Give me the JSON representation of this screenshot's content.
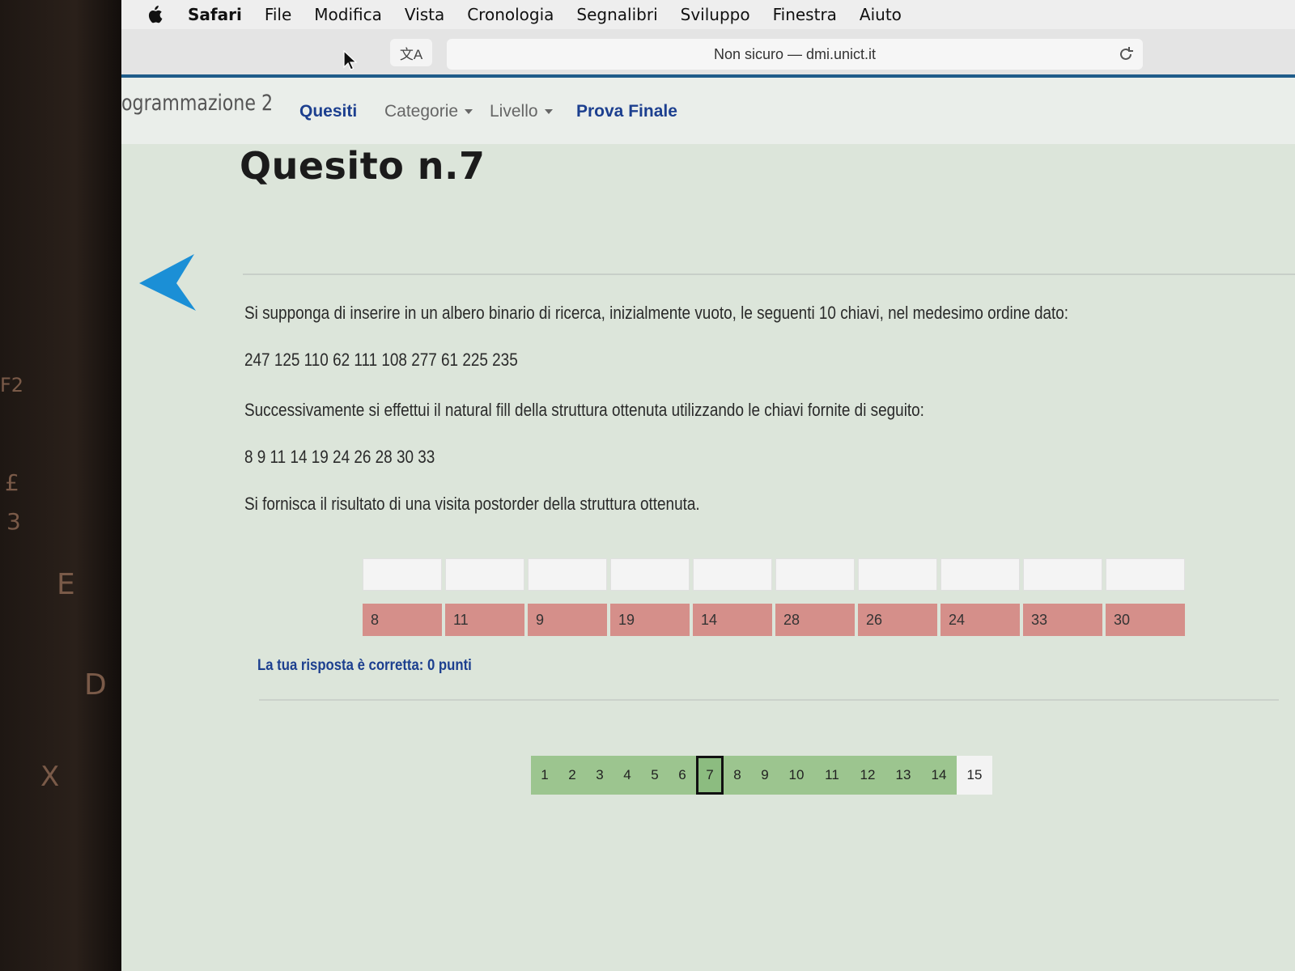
{
  "keyboard": {
    "keys": [
      "F2",
      "£",
      "3",
      "E",
      "D",
      "X"
    ]
  },
  "menubar": {
    "app": "Safari",
    "items": [
      "File",
      "Modifica",
      "Vista",
      "Cronologia",
      "Segnalibri",
      "Sviluppo",
      "Finestra",
      "Aiuto"
    ]
  },
  "toolbar": {
    "translate_label": "文A",
    "address": "Non sicuro — dmi.unict.it"
  },
  "navbar": {
    "brand": "ogrammazione 2",
    "links": {
      "quesiti": "Quesiti",
      "categorie": "Categorie",
      "livello": "Livello",
      "prova_finale": "Prova Finale"
    }
  },
  "question": {
    "title": "Quesito n.7",
    "p1": "Si supponga di inserire in un albero binario di ricerca, inizialmente vuoto, le seguenti 10 chiavi, nel medesimo ordine dato:",
    "keys_insert": "247 125 110 62 111 108 277 61 225 235",
    "p2": "Successivamente si effettui il natural fill della struttura ottenuta utilizzando le chiavi fornite di seguito:",
    "keys_fill": "8 9 11 14 19 24 26 28 30 33",
    "p3": "Si fornisca il risultato di una visita postorder della struttura ottenuta."
  },
  "answer": {
    "inputs": [
      "",
      "",
      "",
      "",
      "",
      "",
      "",
      "",
      "",
      ""
    ],
    "solution": [
      "8",
      "11",
      "9",
      "19",
      "14",
      "28",
      "26",
      "24",
      "33",
      "30"
    ]
  },
  "result": {
    "message": "La tua risposta è corretta: 0 punti"
  },
  "pagination": {
    "pages": [
      "1",
      "2",
      "3",
      "4",
      "5",
      "6",
      "7",
      "8",
      "9",
      "10",
      "11",
      "12",
      "13",
      "14",
      "15"
    ],
    "current": "7"
  },
  "colors": {
    "accent": "#1c3f8f",
    "arrow": "#1b8fd6",
    "solution_bg": "#d58f8a",
    "pagination_bg": "#9cc58f"
  }
}
